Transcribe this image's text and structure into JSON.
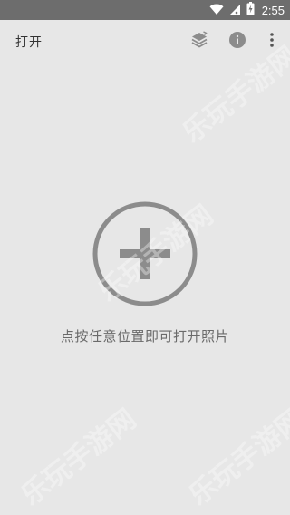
{
  "status_bar": {
    "time": "2:55",
    "icons": [
      "wifi-icon",
      "signal-icon",
      "battery-icon"
    ]
  },
  "app_bar": {
    "title": "打开",
    "actions": [
      "layers-sync-icon",
      "info-icon",
      "more-vert-icon"
    ]
  },
  "main": {
    "add_icon": "add-circle-icon",
    "hint": "点按任意位置即可打开照片"
  },
  "watermark": {
    "text": "乐玩手游网"
  },
  "colors": {
    "background": "#e7e7e7",
    "status_bar": "#6d6d6d",
    "icon_gray": "#8c8c8c",
    "hint_text": "#6a6a6a"
  }
}
